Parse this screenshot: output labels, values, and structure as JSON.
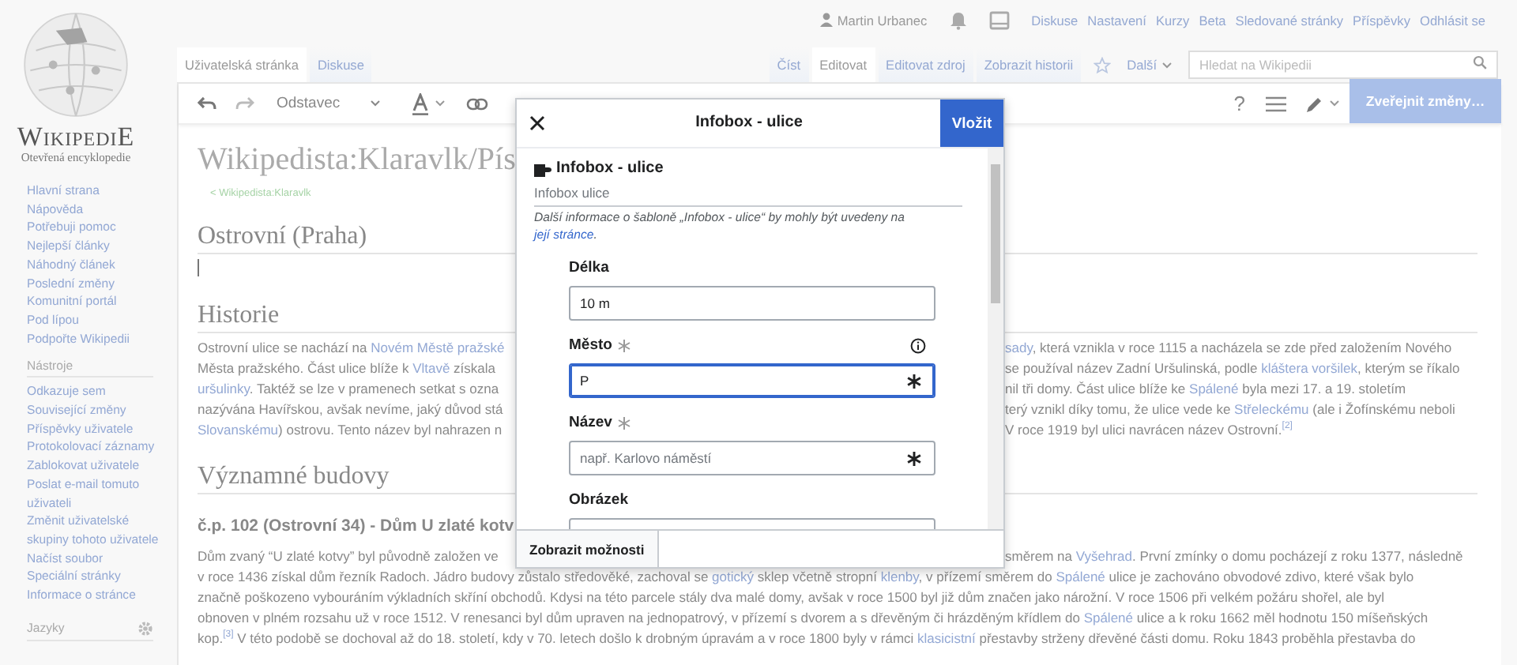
{
  "personal_tools": {
    "user": "Martin Urbanec",
    "links": [
      "Diskuse",
      "Nastavení",
      "Kurzy",
      "Beta",
      "Sledované stránky",
      "Příspěvky",
      "Odhlásit se"
    ]
  },
  "logo": {
    "wordmark": "WikipediE",
    "tagline": "Otevřená encyklopedie"
  },
  "sidebar": {
    "navigation": [
      "Hlavní strana",
      "Nápověda",
      "Potřebuji pomoc",
      "Nejlepší články",
      "Náhodný článek",
      "Poslední změny",
      "Komunitní portál",
      "Pod lípou",
      "Podpořte Wikipedii"
    ],
    "tools_heading": "Nástroje",
    "tools": [
      "Odkazuje sem",
      "Související změny",
      "Příspěvky uživatele",
      "Protokolovací záznamy",
      "Zablokovat uživatele",
      "Poslat e-mail tomuto uživateli",
      "Změnit uživatelské skupiny tohoto uživatele",
      "Načíst soubor",
      "Speciální stránky",
      "Informace o stránce"
    ],
    "languages_heading": "Jazyky"
  },
  "namespace_tabs": [
    {
      "label": "Uživatelská stránka",
      "selected": true
    },
    {
      "label": "Diskuse",
      "selected": false
    }
  ],
  "view_tabs": [
    {
      "label": "Číst",
      "selected": false
    },
    {
      "label": "Editovat",
      "selected": true
    },
    {
      "label": "Editovat zdroj",
      "selected": false
    },
    {
      "label": "Zobrazit historii",
      "selected": false
    }
  ],
  "more_menu": "Další",
  "search": {
    "placeholder": "Hledat na Wikipedii"
  },
  "toolbar": {
    "paragraph_format": "Odstavec",
    "help": "?",
    "publish_button": "Zveřejnit změny…"
  },
  "article": {
    "title": "Wikipedista:Klaravlk/Pís",
    "breadcrumb": "< Wikipedista:Klaravlk",
    "blocks": [
      {
        "kind": "heading",
        "text": "Ostrovní (Praha)"
      },
      {
        "kind": "cursor"
      },
      {
        "kind": "heading",
        "text": "Historie"
      },
      {
        "kind": "paragraph",
        "lines": [
          {
            "left": [
              {
                "kind": "text",
                "text": "Ostrovní ulice se nachází na "
              },
              {
                "kind": "link",
                "text": "Novém Městě pražské"
              }
            ],
            "right": [
              {
                "kind": "link",
                "text": "sady"
              },
              {
                "kind": "text",
                "text": ", která vznikla v roce 1115 a nacházela se zde před založením Nového"
              }
            ]
          },
          {
            "left": [
              {
                "kind": "text",
                "text": "Města pražského. Část ulice blíže k "
              },
              {
                "kind": "link",
                "text": "Vltavě"
              },
              {
                "kind": "text",
                "text": " získala"
              }
            ],
            "right": [
              {
                "kind": "text",
                "text": "se používal název Zadní Uršulinská, podle "
              },
              {
                "kind": "link",
                "text": "kláštera voršilek"
              },
              {
                "kind": "text",
                "text": ", kterým se říkalo"
              }
            ]
          },
          {
            "left": [
              {
                "kind": "link",
                "text": "uršulinky"
              },
              {
                "kind": "text",
                "text": ". Taktéž se lze v pramenech setkat s ozna"
              }
            ],
            "right": [
              {
                "kind": "text",
                "text": "nil tři domy. Část ulice blíže ke "
              },
              {
                "kind": "link",
                "text": "Spálené"
              },
              {
                "kind": "text",
                "text": " byla mezi 17. a 19. stoletím"
              }
            ]
          },
          {
            "left": [
              {
                "kind": "text",
                "text": "nazývána Havířskou, avšak nevíme, jaký důvod stá"
              }
            ],
            "right": [
              {
                "kind": "text",
                "text": "terý vznikl díky tomu, že ulice vede ke "
              },
              {
                "kind": "link",
                "text": "Střeleckému"
              },
              {
                "kind": "text",
                "text": " (ale i Žofínskému neboli"
              }
            ]
          },
          {
            "left": [
              {
                "kind": "link",
                "text": "Slovanskému"
              },
              {
                "kind": "text",
                "text": ") ostrovu. Tento název byl nahrazen n"
              }
            ],
            "right": [
              {
                "kind": "text",
                "text": "V roce 1919 byl ulici navrácen název Ostrovní."
              },
              {
                "kind": "ref",
                "text": "[2]"
              }
            ]
          }
        ]
      },
      {
        "kind": "heading",
        "text": "Významné budovy"
      },
      {
        "kind": "subheading",
        "text": "č.p. 102 (Ostrovní 34) - Dům U zlaté kotv"
      },
      {
        "kind": "paragraph",
        "lines": [
          {
            "left": [
              {
                "kind": "text",
                "text": "Dům zvaný “U zlaté kotvy” byl původně založen ve"
              }
            ],
            "right": [
              {
                "kind": "text",
                "text": "směrem na "
              },
              {
                "kind": "link",
                "text": "Vyšehrad"
              },
              {
                "kind": "text",
                "text": ". První zmínky o domu pocházejí z roku 1377, následně"
              }
            ]
          },
          {
            "full": [
              {
                "kind": "text",
                "text": "v roce 1436 získal dům řezník Radoch. Jádro budovy zůstalo středověké, zachoval se "
              },
              {
                "kind": "link",
                "text": "gotický"
              },
              {
                "kind": "text",
                "text": " sklep včetně stropní "
              },
              {
                "kind": "link",
                "text": "klenby"
              },
              {
                "kind": "text",
                "text": ", v přízemí směrem do "
              },
              {
                "kind": "link",
                "text": "Spálené"
              },
              {
                "kind": "text",
                "text": " ulice je zachováno obvodové zdivo, které však bylo"
              }
            ]
          },
          {
            "full": [
              {
                "kind": "text",
                "text": "značně poškozeno vybouráním výkladních skříní obchodů. Kdysi na této parcele stály dva malé domy, avšak v roce 1500 byl již dům značen jako nárožní. V roce 1506 při velkém požáru shořel, ale byl"
              }
            ]
          },
          {
            "full": [
              {
                "kind": "text",
                "text": "obnoven v plném rozsahu už v roce 1512. V renesanci byl dům upraven na jednopatrový, v přízemí s dvorem a s dřevěným či hrázděným křídlem do "
              },
              {
                "kind": "link",
                "text": "Spálené"
              },
              {
                "kind": "text",
                "text": " ulice a k roku 1662 měl hodnotu 150 míšeňských"
              }
            ]
          },
          {
            "full": [
              {
                "kind": "text",
                "text": "kop."
              },
              {
                "kind": "ref",
                "text": "[3]"
              },
              {
                "kind": "text",
                "text": " V této podobě se dochoval až do 18. století, kdy v 70. letech došlo k drobným úpravám a v roce 1800 byly v rámci "
              },
              {
                "kind": "link",
                "text": "klasicistní"
              },
              {
                "kind": "text",
                "text": " přestavby strženy dřevěné části domu. Roku 1843 proběhla přestavba do"
              }
            ]
          }
        ]
      }
    ]
  },
  "dialog": {
    "title": "Infobox - ulice",
    "insert_button": "Vložit",
    "template_name": "Infobox - ulice",
    "template_title": "Infobox ulice",
    "description": "Další informace o šabloně „Infobox - ulice“ by mohly být uvedeny na ",
    "description_link": "její stránce",
    "description_end": ".",
    "fields": [
      {
        "label": "Délka",
        "required": false,
        "info": false,
        "focused": false,
        "value": "10 m"
      },
      {
        "label": "Město",
        "required": true,
        "info": true,
        "focused": true,
        "value": "P"
      },
      {
        "label": "Název",
        "required": true,
        "info": false,
        "focused": false,
        "placeholder": "např. Karlovo náměstí"
      },
      {
        "label": "Obrázek",
        "required": false,
        "info": false,
        "focused": false
      }
    ],
    "options_button": "Zobrazit možnosti"
  }
}
